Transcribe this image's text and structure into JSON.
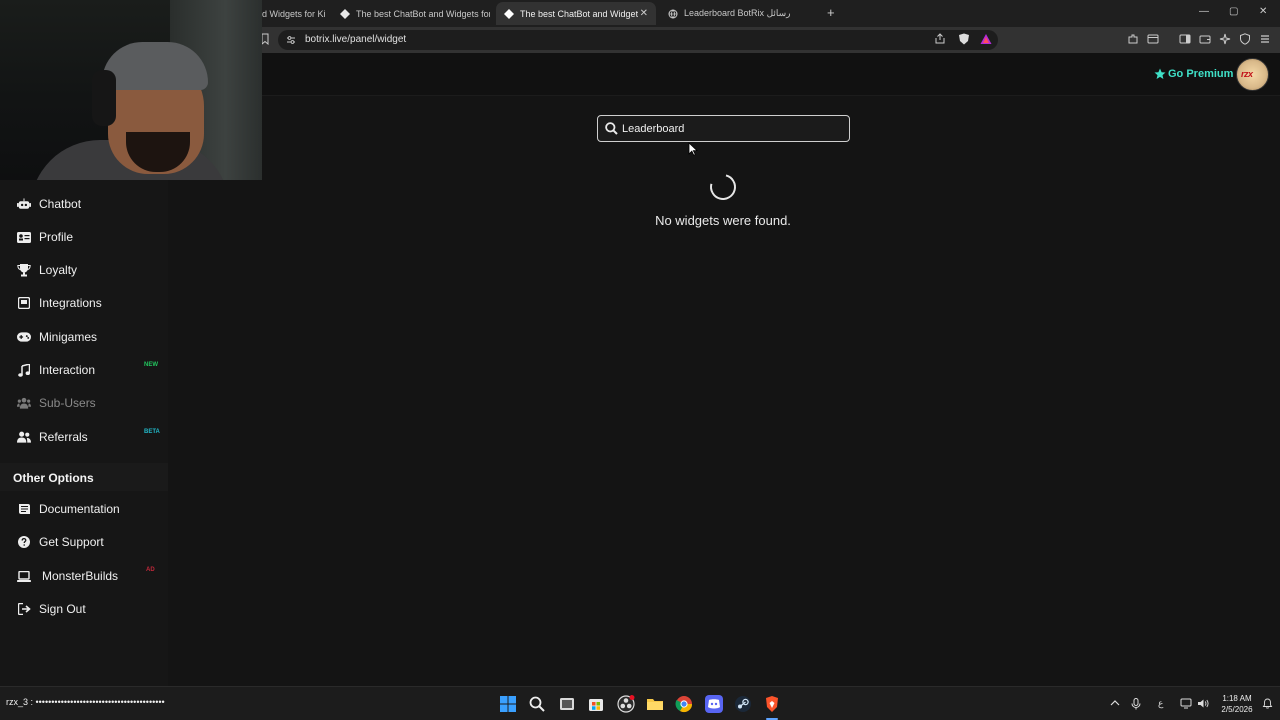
{
  "browser": {
    "tabs": [
      {
        "title": "d Widgets for Ki",
        "active": false
      },
      {
        "title": "The best ChatBot and Widgets for Ki",
        "active": false
      },
      {
        "title": "The best ChatBot and Widgets fo",
        "active": true
      },
      {
        "title": "Leaderboard BotRix رسائل",
        "active": false
      }
    ],
    "new_tab": "+",
    "address": "botrix.live/panel/widget",
    "window_controls": {
      "minimize": "—",
      "maximize": "▢",
      "close": "✕"
    }
  },
  "header": {
    "premium_label": "Go Premium",
    "premium_icon": "star-icon",
    "accent_color": "#3fe0c7",
    "avatar_text": "rzx"
  },
  "sidebar": {
    "items": [
      {
        "label": "Chatbot",
        "icon": "robot-icon"
      },
      {
        "label": "Profile",
        "icon": "id-card-icon"
      },
      {
        "label": "Loyalty",
        "icon": "trophy-icon"
      },
      {
        "label": "Integrations",
        "icon": "plug-icon"
      },
      {
        "label": "Minigames",
        "icon": "gamepad-icon"
      },
      {
        "label": "Interaction",
        "icon": "music-icon",
        "badge": "NEW",
        "badge_color": "#22c55e"
      },
      {
        "label": "Sub-Users",
        "icon": "users-icon",
        "disabled": true
      },
      {
        "label": "Referrals",
        "icon": "user-group-icon",
        "badge": "BETA",
        "badge_color": "#22b8c8"
      }
    ],
    "other_title": "Other Options",
    "other_items": [
      {
        "label": "Documentation",
        "icon": "book-icon"
      },
      {
        "label": "Get Support",
        "icon": "question-icon"
      },
      {
        "label": "MonsterBuilds",
        "icon": "laptop-icon",
        "badge": "AD",
        "badge_color": "#c0283a"
      },
      {
        "label": "Sign Out",
        "icon": "sign-out-icon"
      }
    ]
  },
  "main": {
    "search_value": "Leaderboard",
    "empty_message": "No widgets were found."
  },
  "taskbar": {
    "user_text": "rzx_3 : •••••••••••••••••••••••••••••••••••••••••",
    "clock_time": "1:18 AM",
    "clock_date": "2/5/2026",
    "lang": "ع"
  }
}
